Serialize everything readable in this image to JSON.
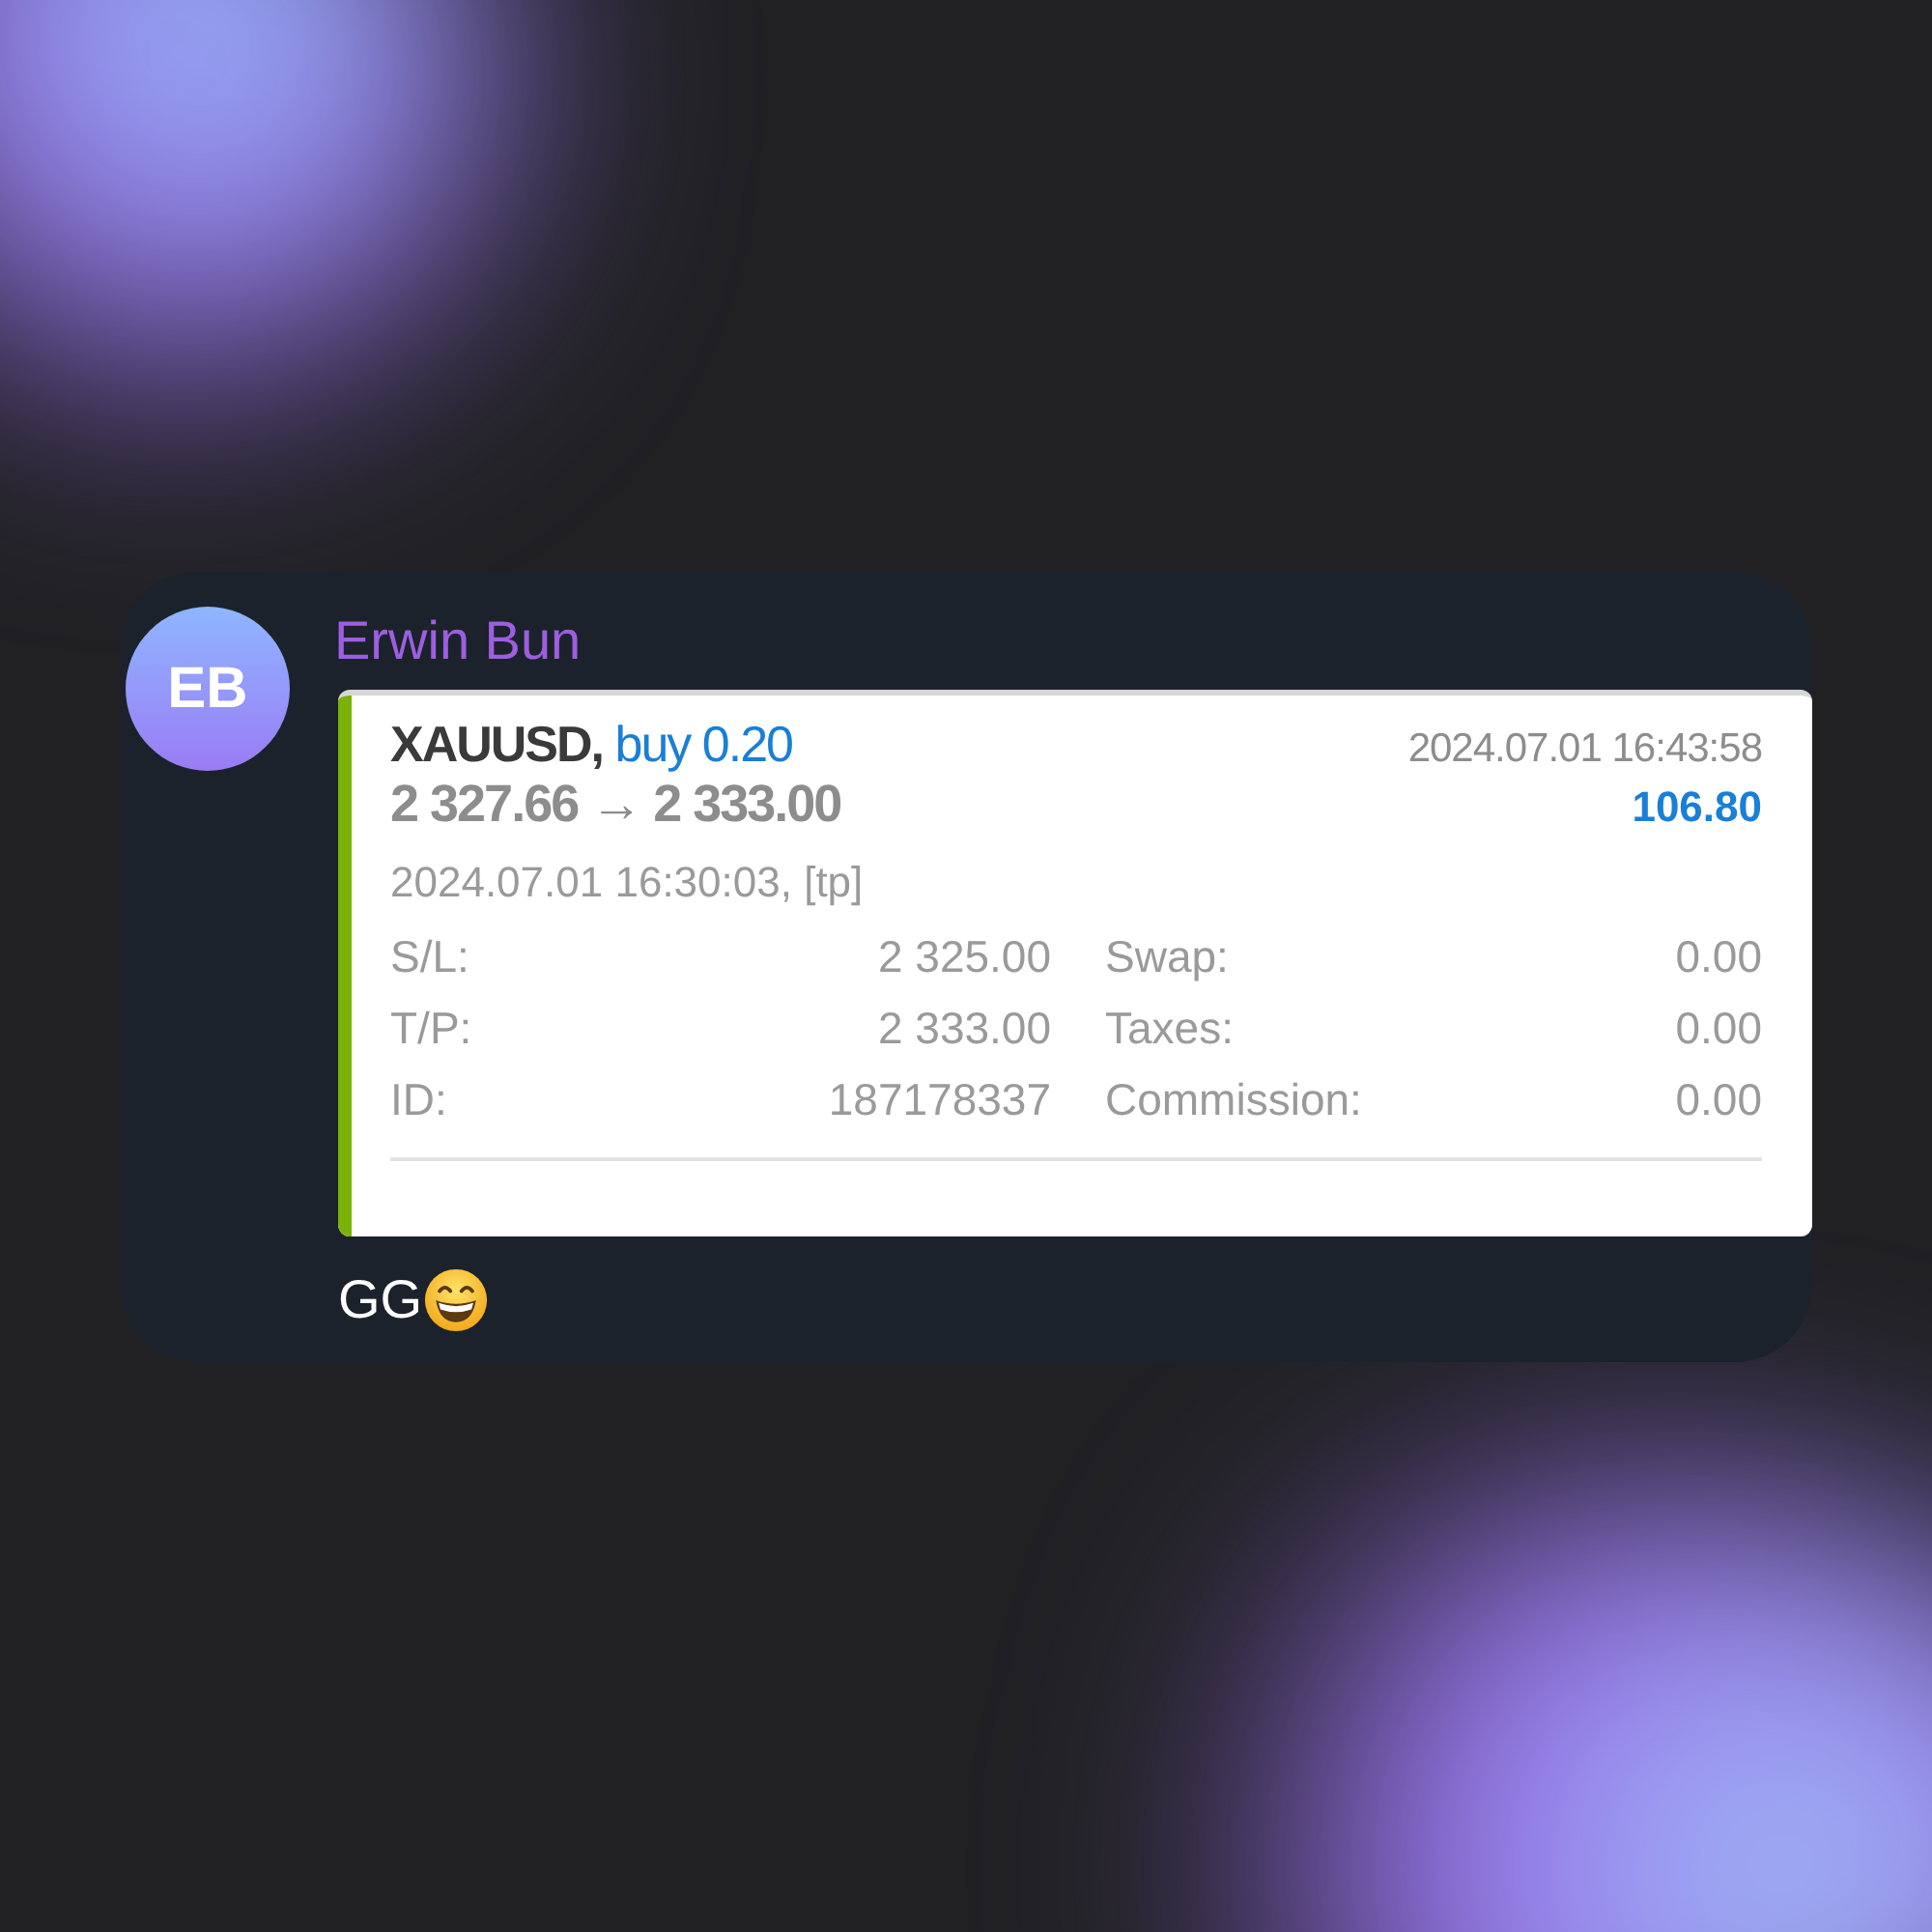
{
  "message": {
    "avatar_initials": "EB",
    "sender": "Erwin Bun",
    "trade": {
      "symbol": "XAUUSD,",
      "side": "buy 0.20",
      "prices": "2 327.66 → 2 333.00",
      "close_time": "2024.07.01 16:43:58",
      "profit": "106.80",
      "open_info": "2024.07.01 16:30:03, [tp]",
      "details": [
        {
          "label": "S/L:",
          "value": "2 325.00"
        },
        {
          "label": "Swap:",
          "value": "0.00"
        },
        {
          "label": "T/P:",
          "value": "2 333.00"
        },
        {
          "label": "Taxes:",
          "value": "0.00"
        },
        {
          "label": "ID:",
          "value": "187178337"
        },
        {
          "label": "Commission:",
          "value": "0.00"
        }
      ]
    },
    "text": "GG"
  }
}
